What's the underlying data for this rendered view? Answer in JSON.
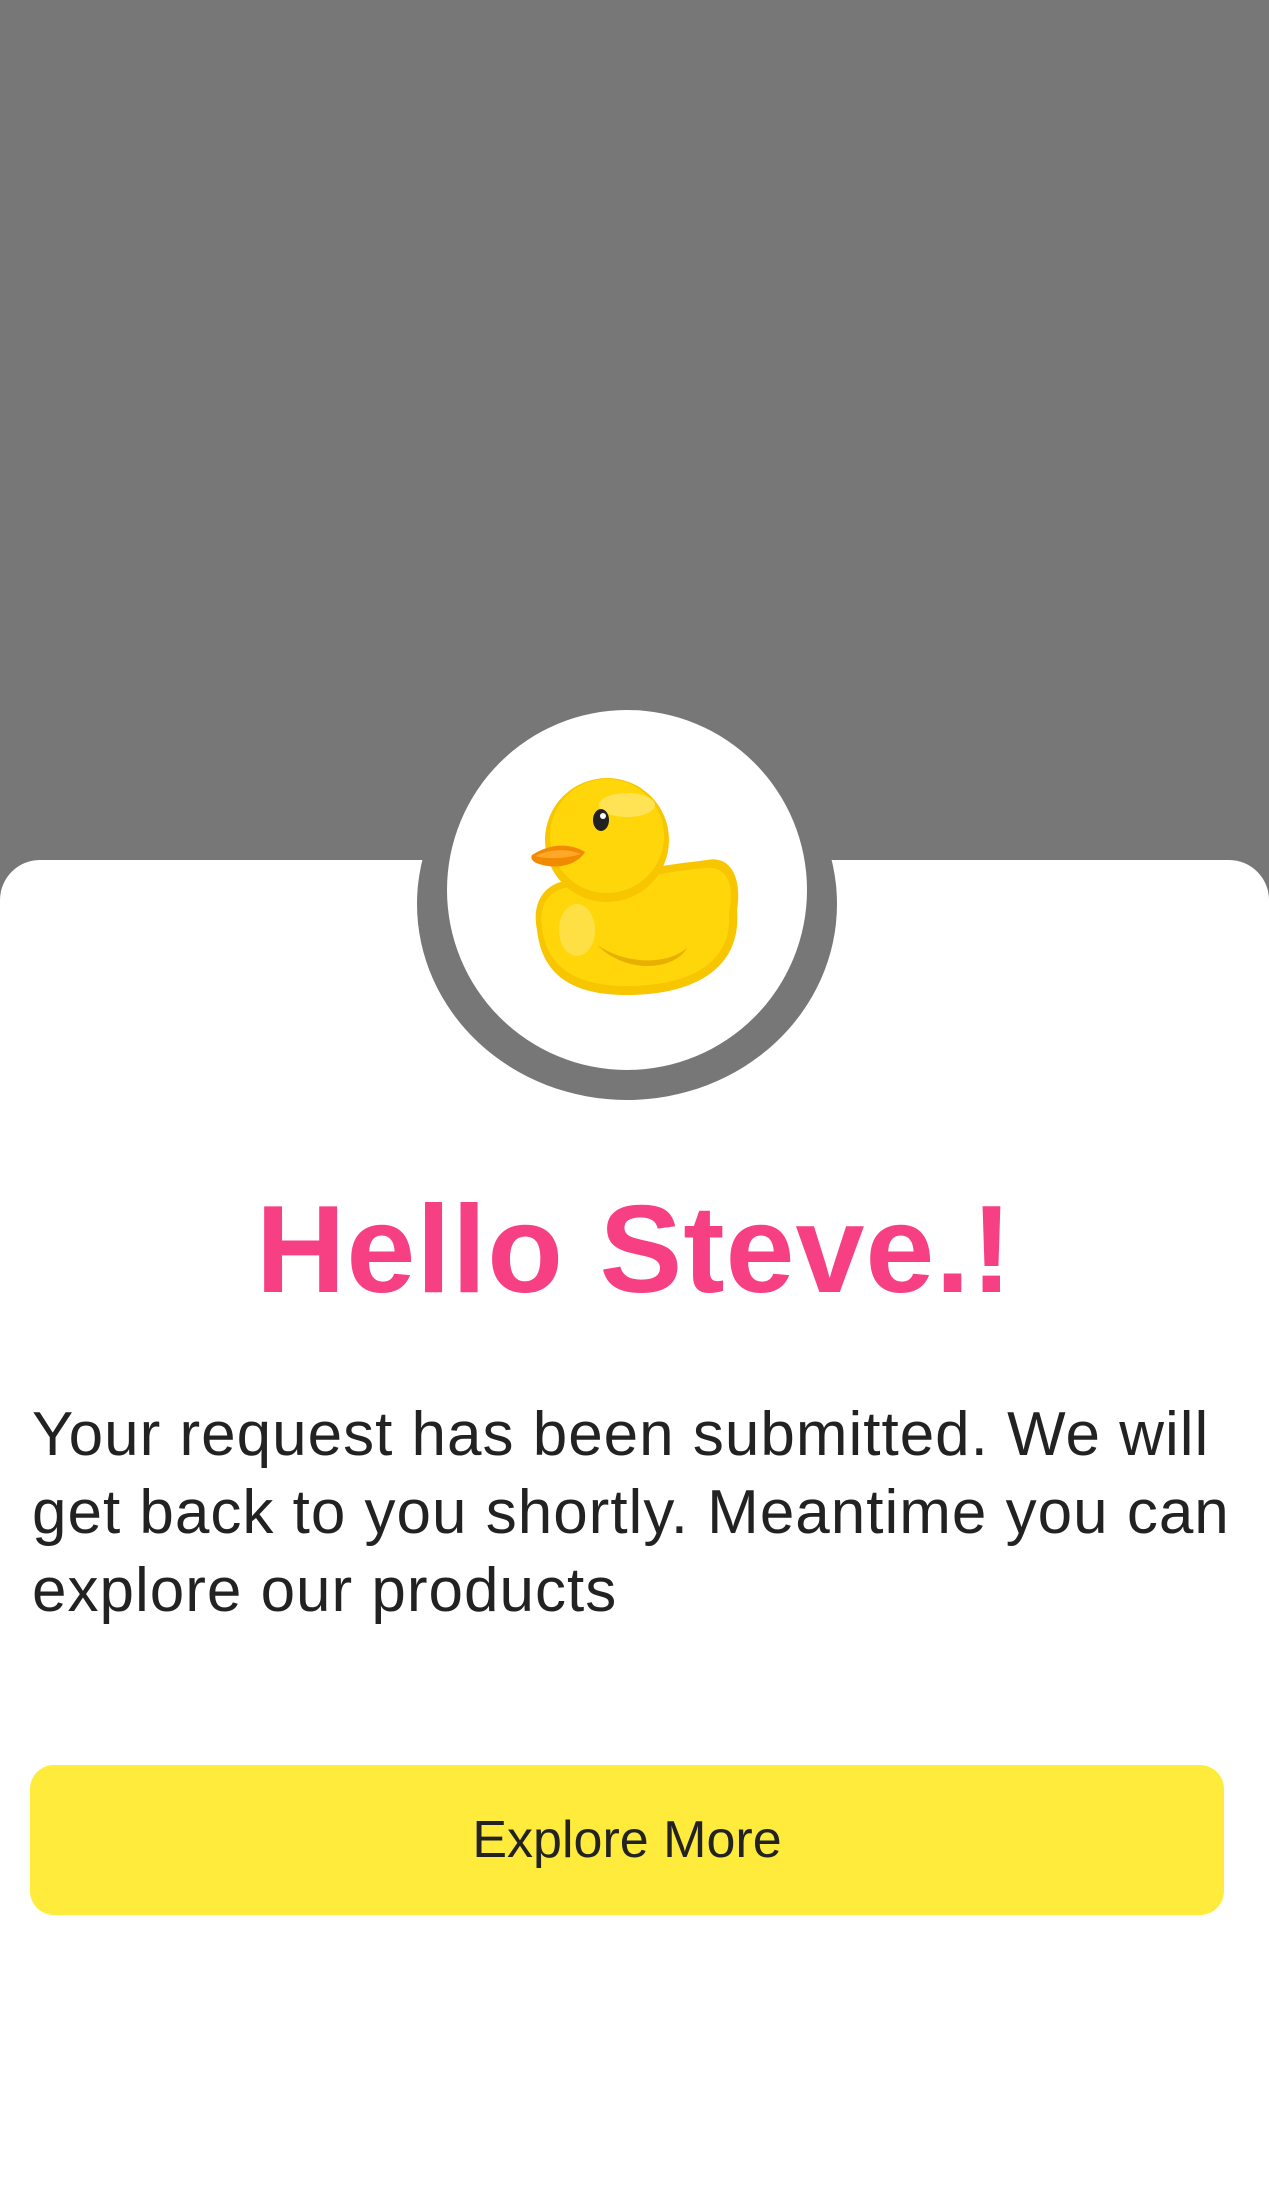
{
  "greeting": "Hello Steve.!",
  "message": "Your request has been submitted. We will get back to you shortly. Meantime you can explore our products",
  "button": {
    "label": "Explore More"
  },
  "avatar": {
    "icon": "rubber-duck-icon"
  },
  "colors": {
    "backdrop": "#777777",
    "greeting": "#f73f83",
    "button": "#ffeb3b",
    "text": "#222222"
  }
}
